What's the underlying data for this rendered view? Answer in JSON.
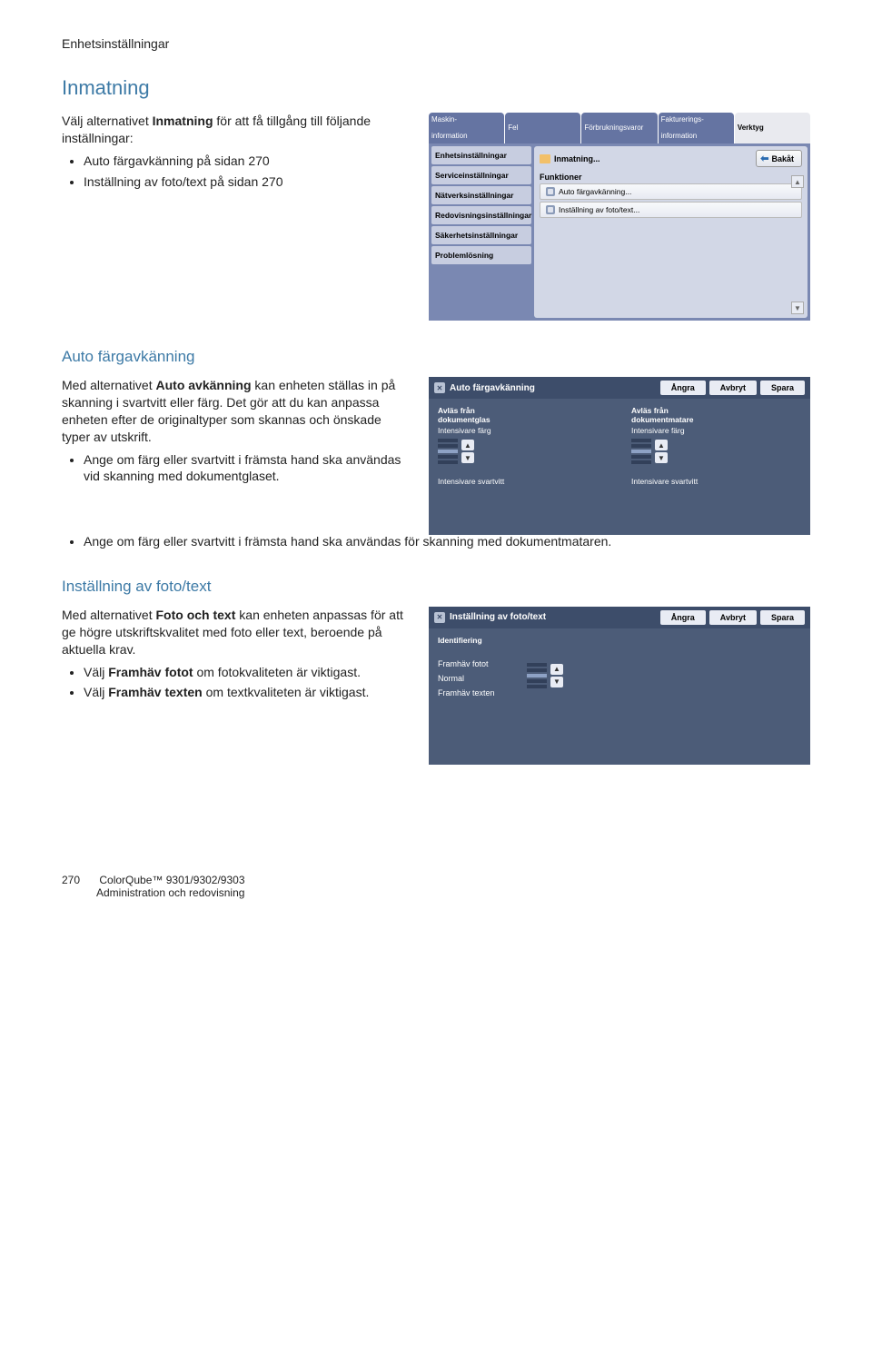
{
  "header": {
    "section_title": "Enhetsinställningar"
  },
  "section_inmatning": {
    "heading": "Inmatning",
    "intro_pre": "Välj alternativet ",
    "intro_bold": "Inmatning",
    "intro_post": " för att få tillgång till följande inställningar:",
    "bullets": [
      "Auto färgavkänning på sidan 270",
      "Inställning av foto/text på sidan 270"
    ]
  },
  "shot1": {
    "tabs": [
      {
        "line1": "Maskin-",
        "line2": "information"
      },
      {
        "line1": "Fel",
        "line2": ""
      },
      {
        "line1": "Förbrukningsvaror",
        "line2": ""
      },
      {
        "line1": "Fakturerings-",
        "line2": "information"
      },
      {
        "line1": "Verktyg",
        "line2": ""
      }
    ],
    "sidebar": [
      "Enhetsinställningar",
      "Serviceinställningar",
      "Nätverksinställningar",
      "Redovisningsinställningar",
      "Säkerhetsinställningar",
      "Problemlösning"
    ],
    "crumb": "Inmatning...",
    "back_label": "Bakåt",
    "section_label": "Funktioner",
    "options": [
      "Auto färgavkänning...",
      "Inställning av foto/text..."
    ]
  },
  "section_auto": {
    "heading": "Auto färgavkänning",
    "para_pre": "Med alternativet ",
    "para_bold": "Auto avkänning",
    "para_post": " kan enheten ställas in på skanning i svartvitt eller färg. Det gör att du kan anpassa enheten efter de originaltyper som skannas och önskade typer av utskrift.",
    "bullets_short": [
      "Ange om färg eller svartvitt i främsta hand ska användas vid skanning med dokumentglaset."
    ],
    "bullet_wide": "Ange om färg eller svartvitt i främsta hand ska användas för skanning med dokumentmataren."
  },
  "dlg_auto": {
    "title": "Auto färgavkänning",
    "buttons": {
      "undo": "Ångra",
      "cancel": "Avbryt",
      "save": "Spara"
    },
    "col1_title1": "Avläs från",
    "col1_title2": "dokumentglas",
    "col2_title1": "Avläs från",
    "col2_title2": "dokumentmatare",
    "label_color": "Intensivare färg",
    "label_bw": "Intensivare svartvitt"
  },
  "section_foto": {
    "heading": "Inställning av foto/text",
    "para_pre": "Med alternativet ",
    "para_bold": "Foto och text",
    "para_post": " kan enheten anpassas för att ge högre utskriftskvalitet med foto eller text, beroende på aktuella krav.",
    "b1_pre": "Välj ",
    "b1_bold": "Framhäv fotot",
    "b1_post": " om fotokvaliteten är viktigast.",
    "b2_pre": "Välj ",
    "b2_bold": "Framhäv texten",
    "b2_post": " om textkvaliteten är viktigast."
  },
  "dlg_foto": {
    "title": "Inställning av foto/text",
    "buttons": {
      "undo": "Ångra",
      "cancel": "Avbryt",
      "save": "Spara"
    },
    "section": "Identifiering",
    "options": [
      "Framhäv fotot",
      "Normal",
      "Framhäv texten"
    ]
  },
  "footer": {
    "page_number": "270",
    "line1": "ColorQube™ 9301/9302/9303",
    "line2": "Administration och redovisning"
  }
}
